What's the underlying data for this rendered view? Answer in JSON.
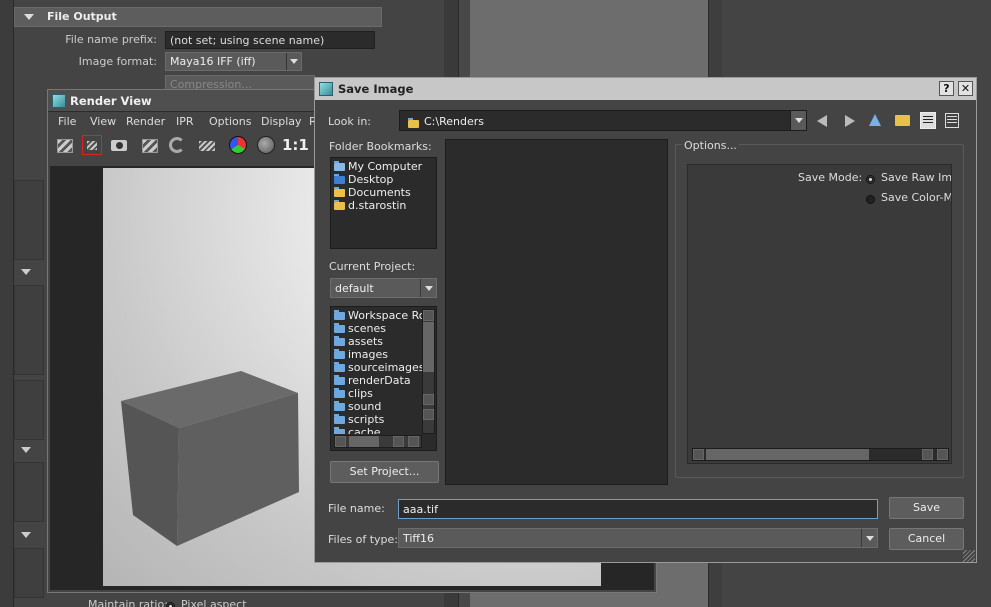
{
  "attribute_editor": {
    "section_title": "File Output",
    "file_name_prefix_label": "File name prefix:",
    "file_name_prefix_value": "(not set; using scene name)",
    "image_format_label": "Image format:",
    "image_format_value": "Maya16 IFF (iff)",
    "compression_label": "Compression...",
    "maintain_ratio_label": "Maintain ratio:",
    "pixel_aspect_label": "Pixel aspect"
  },
  "render_view": {
    "title": "Render View",
    "menu": [
      "File",
      "View",
      "Render",
      "IPR",
      "Options",
      "Display",
      "R"
    ],
    "ratio_label": "1:1",
    "toolbar_icons": [
      "render-clapper-icon",
      "render-region-icon",
      "snapshot-camera-icon",
      "ipr-clapper-icon",
      "refresh-icon",
      "render-settings-icon",
      "color-channels-icon",
      "alpha-channel-icon"
    ]
  },
  "save_dialog": {
    "title": "Save Image",
    "help_button": "?",
    "close_button": "✕",
    "look_in_label": "Look in:",
    "look_in_value": "C:\\Renders",
    "folder_bookmarks_label": "Folder Bookmarks:",
    "bookmarks": [
      "My Computer",
      "Desktop",
      "Documents",
      "d.starostin"
    ],
    "current_project_label": "Current Project:",
    "current_project_value": "default",
    "project_folders": [
      "Workspace Roo",
      "scenes",
      "assets",
      "images",
      "sourceimages",
      "renderData",
      "clips",
      "sound",
      "scripts",
      "cache"
    ],
    "set_project_button": "Set Project...",
    "options_label": "Options...",
    "save_mode_label": "Save Mode:",
    "save_mode_options": [
      "Save Raw Ima",
      "Save Color-Ma"
    ],
    "file_name_label": "File name:",
    "file_name_value": "aaa.tif",
    "files_of_type_label": "Files of type:",
    "files_of_type_value": "Tiff16",
    "save_button": "Save",
    "cancel_button": "Cancel"
  }
}
